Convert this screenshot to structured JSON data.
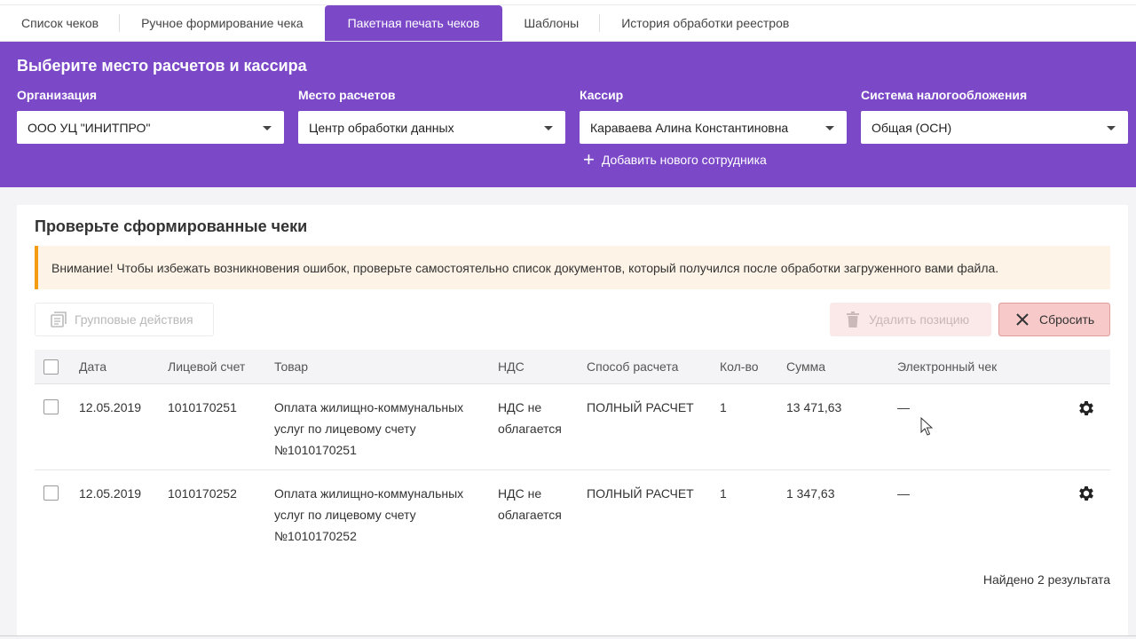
{
  "tabs": [
    {
      "label": "Список чеков"
    },
    {
      "label": "Ручное формирование чека"
    },
    {
      "label": "Пакетная печать чеков"
    },
    {
      "label": "Шаблоны"
    },
    {
      "label": "История обработки реестров"
    }
  ],
  "panel": {
    "title": "Выберите место расчетов и кассира",
    "fields": {
      "organization": {
        "label": "Организация",
        "value": "ООО УЦ \"ИНИТПРО\""
      },
      "place": {
        "label": "Место расчетов",
        "value": "Центр обработки данных"
      },
      "cashier": {
        "label": "Кассир",
        "value": "Караваева Алина Константиновна"
      },
      "tax": {
        "label": "Система налогообложения",
        "value": "Общая (ОСН)"
      }
    },
    "add_employee": "Добавить нового сотрудника"
  },
  "card": {
    "title": "Проверьте сформированные чеки",
    "warning": "Внимание! Чтобы избежать возникновения ошибок, проверьте самостоятельно список документов, который получился после обработки загруженного вами файла.",
    "group_actions": "Групповые действия",
    "delete_position": "Удалить позицию",
    "reset": "Сбросить"
  },
  "table": {
    "headers": {
      "date": "Дата",
      "account": "Лицевой счет",
      "product": "Товар",
      "vat": "НДС",
      "payment": "Способ расчета",
      "qty": "Кол-во",
      "sum": "Сумма",
      "ereceipt": "Электронный чек"
    },
    "rows": [
      {
        "date": "12.05.2019",
        "account": "1010170251",
        "product_l1": "Оплата жилищно-коммунальных",
        "product_l2": "услуг по лицевому счету",
        "product_l3": "№1010170251",
        "vat_l1": "НДС не",
        "vat_l2": "облагается",
        "payment": "ПОЛНЫЙ РАСЧЕТ",
        "qty": "1",
        "sum": "13 471,63",
        "ereceipt": "—"
      },
      {
        "date": "12.05.2019",
        "account": "1010170252",
        "product_l1": "Оплата жилищно-коммунальных",
        "product_l2": "услуг по лицевому счету",
        "product_l3": "№1010170252",
        "vat_l1": "НДС не",
        "vat_l2": "облагается",
        "payment": "ПОЛНЫЙ РАСЧЕТ",
        "qty": "1",
        "sum": "1 347,63",
        "ereceipt": "—"
      }
    ],
    "found": "Найдено 2 результата"
  },
  "colors": {
    "accent": "#7b48c8",
    "warning_border": "#f39c12",
    "warning_bg": "#fdf3e6",
    "reset_bg": "#f7c9c9"
  }
}
